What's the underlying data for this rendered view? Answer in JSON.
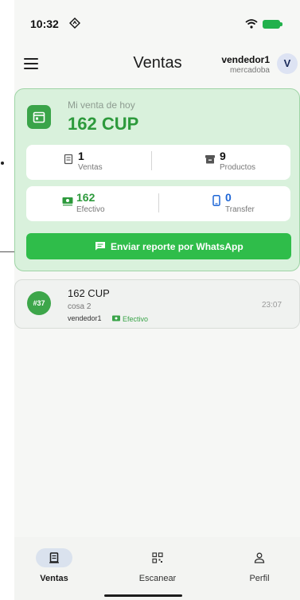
{
  "status_bar": {
    "time": "10:32"
  },
  "app_bar": {
    "title": "Ventas",
    "user_name": "vendedor1",
    "user_store": "mercadoba",
    "avatar_initial": "V"
  },
  "today": {
    "label": "Mi venta de hoy",
    "amount": "162 CUP",
    "stats": [
      {
        "value": "1",
        "label": "Ventas",
        "icon": "receipt-icon"
      },
      {
        "value": "9",
        "label": "Productos",
        "icon": "inventory-box-icon"
      },
      {
        "value": "162",
        "label": "Efectivo",
        "icon": "cash-icon"
      },
      {
        "value": "0",
        "label": "Transfer",
        "icon": "phone-icon"
      }
    ],
    "whatsapp_button": "Enviar reporte por WhatsApp"
  },
  "sales": [
    {
      "number": "#37",
      "amount": "162 CUP",
      "item": "cosa 2",
      "seller": "vendedor1",
      "payment": "Efectivo",
      "time": "23:07"
    }
  ],
  "bottom_nav": [
    {
      "label": "Ventas",
      "icon": "receipt-icon",
      "active": true
    },
    {
      "label": "Escanear",
      "icon": "qr-scan-icon",
      "active": false
    },
    {
      "label": "Perfil",
      "icon": "person-icon",
      "active": false
    }
  ],
  "colors": {
    "accent_green": "#2d9a3c",
    "card_bg": "#d9f1dc",
    "whatsapp_green": "#2fbd4a",
    "transfer_blue": "#1e66d6",
    "nav_active_pill": "#dae2ee"
  }
}
